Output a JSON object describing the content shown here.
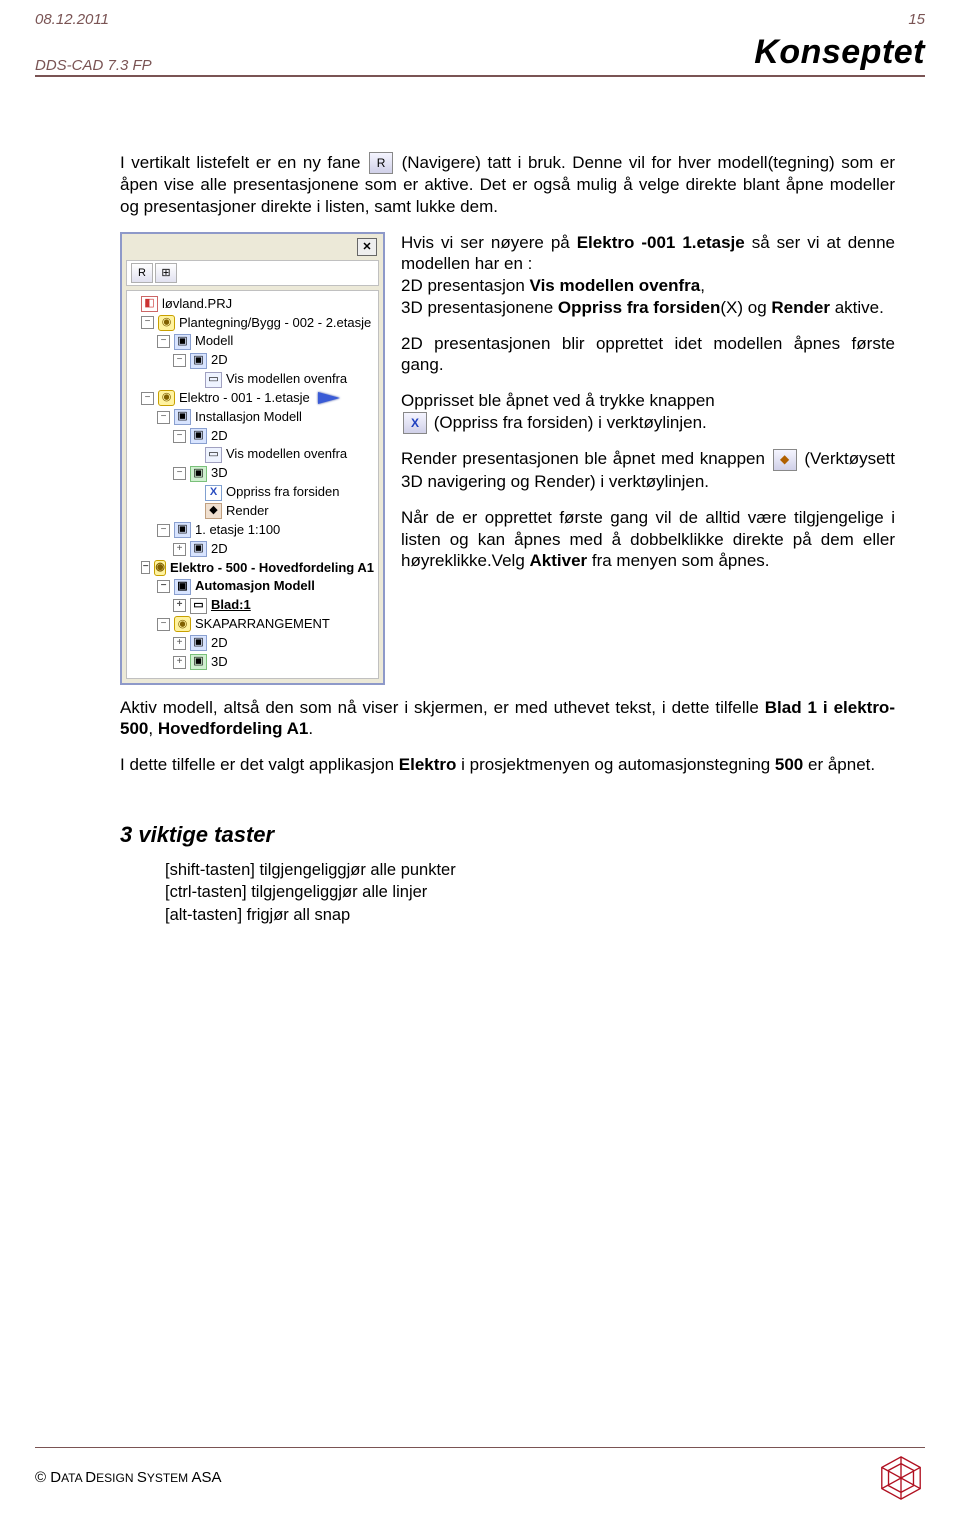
{
  "header": {
    "date": "08.12.2011",
    "page_no": "15",
    "product": "DDS-CAD 7.3 FP",
    "title": "Konseptet"
  },
  "intro": {
    "p1_a": "I vertikalt listefelt er en ny fane ",
    "p1_b": " (Navigere) tatt i bruk. Denne vil for hver modell(tegning) som er åpen vise alle presentasjonene som er aktive. Det er også mulig å velge direkte blant åpne modeller og presentasjoner direkte i listen, samt lukke dem.",
    "nav_icon": "R"
  },
  "panel": {
    "tool_glyph1": "R",
    "tool_glyph2": "⊞",
    "close": "✕"
  },
  "tree": {
    "r0": "løvland.PRJ",
    "r1": "Plantegning/Bygg - 002 - 2.etasje",
    "r2": "Modell",
    "r3": "2D",
    "r4": "Vis modellen ovenfra",
    "r5": "Elektro - 001 - 1.etasje",
    "r6": "Installasjon Modell",
    "r7": "2D",
    "r8": "Vis modellen ovenfra",
    "r9": "3D",
    "r10": "Oppriss fra forsiden",
    "r11": "Render",
    "r12": "1. etasje 1:100",
    "r13": "2D",
    "r14": "Elektro - 500 - Hovedfordeling A1",
    "r15": "Automasjon Modell",
    "r16": "Blad:1",
    "r17": "SKAPARRANGEMENT",
    "r18": "2D",
    "r19": "3D"
  },
  "right": {
    "p1_a": "Hvis vi ser nøyere på ",
    "p1_b": "Elektro -001 1.etasje",
    "p1_c": " så ser vi at denne modellen har en :",
    "p1_d": "2D presentasjon ",
    "p1_e": "Vis modellen ovenfra",
    "p1_f": ",",
    "p1_g": "3D presentasjonene ",
    "p1_h": "Oppriss fra forsiden",
    "p1_i": "(X) og ",
    "p1_j": "Render",
    "p1_k": " aktive.",
    "p2": "2D presentasjonen blir opprettet idet modellen åpnes første gang.",
    "p3_a": "Opprisset ble åpnet ved å trykke knappen ",
    "p3_b": " (Oppriss fra forsiden) i verktøylinjen.",
    "icon_p3": "X",
    "p4_a": "Render presentasjonen ble åpnet med knappen ",
    "p4_b": " (Verktøysett 3D navigering og Render) i verktøylinjen.",
    "icon_p4": "◆",
    "p5_a": "Når de er opprettet første gang vil de alltid være tilgjengelige i listen og kan åpnes med å dobbelklikke direkte på dem eller høyreklikke.Velg ",
    "p5_b": "Aktiver",
    "p5_c": " fra menyen som åpnes."
  },
  "after": {
    "p1_a": "Aktiv modell, altså den som nå viser i skjermen, er med uthevet tekst, i dette tilfelle ",
    "p1_b": "Blad 1 i elektro- 500",
    "p1_c": ", ",
    "p1_d": "Hovedfordeling A1",
    "p1_e": ".",
    "p2_a": "I dette tilfelle er det valgt applikasjon ",
    "p2_b": "Elektro",
    "p2_c": " i prosjektmenyen og automasjonstegning ",
    "p2_d": "500",
    "p2_e": " er åpnet."
  },
  "section": {
    "heading": "3 viktige taster",
    "l1": "[shift-tasten] tilgjengeliggjør alle punkter",
    "l2": "[ctrl-tasten] tilgjengeliggjør alle linjer",
    "l3": "[alt-tasten] frigjør all snap"
  },
  "footer": {
    "copyright_a": "© D",
    "copyright_b": "ATA ",
    "copyright_c": "D",
    "copyright_d": "ESIGN ",
    "copyright_e": "S",
    "copyright_f": "YSTEM ",
    "copyright_g": "ASA"
  }
}
